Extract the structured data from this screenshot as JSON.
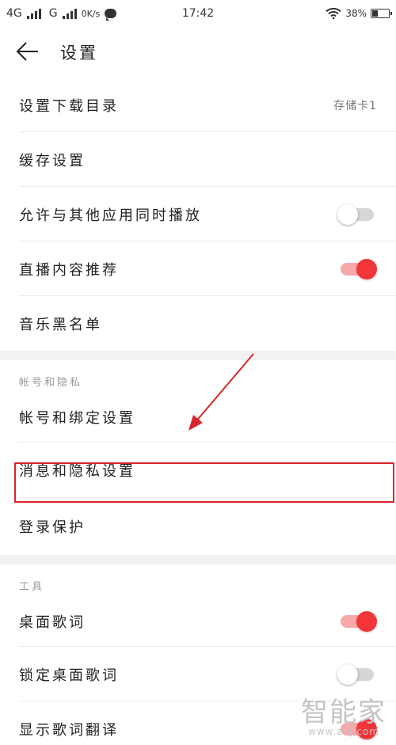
{
  "status_bar": {
    "network1": "4G",
    "network2": "G",
    "speed": "0K/s",
    "time": "17:42",
    "battery": "38%",
    "battery_level": 0.38,
    "icons": [
      "signal-icon",
      "chat-bubble-icon",
      "wifi-icon",
      "battery-icon"
    ]
  },
  "header": {
    "title": "设置",
    "back_icon": "arrow-left-icon"
  },
  "items": {
    "download_dir": {
      "label": "设置下载目录",
      "value": "存储卡1"
    },
    "cache": {
      "label": "缓存设置"
    },
    "mix_play": {
      "label": "允许与其他应用同时播放",
      "on": false
    },
    "live_recommend": {
      "label": "直播内容推荐",
      "on": true
    },
    "blacklist": {
      "label": "音乐黑名单"
    },
    "account_binding": {
      "label": "帐号和绑定设置"
    },
    "message_privacy": {
      "label": "消息和隐私设置"
    },
    "login_protect": {
      "label": "登录保护"
    },
    "desktop_lyrics": {
      "label": "桌面歌词",
      "on": true
    },
    "lock_desktop_lyrics": {
      "label": "锁定桌面歌词",
      "on": false
    },
    "show_translation": {
      "label": "显示歌词翻译",
      "on": true
    }
  },
  "sections": {
    "account_privacy": "帐号和隐私",
    "tools": "工具"
  },
  "colors": {
    "accent": "#f2353a",
    "annotation": "#d9262b",
    "divider": "#ececec",
    "section_bg": "#f2f2f2"
  },
  "watermark": {
    "logo": "智能家",
    "url": "www.znj.com"
  }
}
